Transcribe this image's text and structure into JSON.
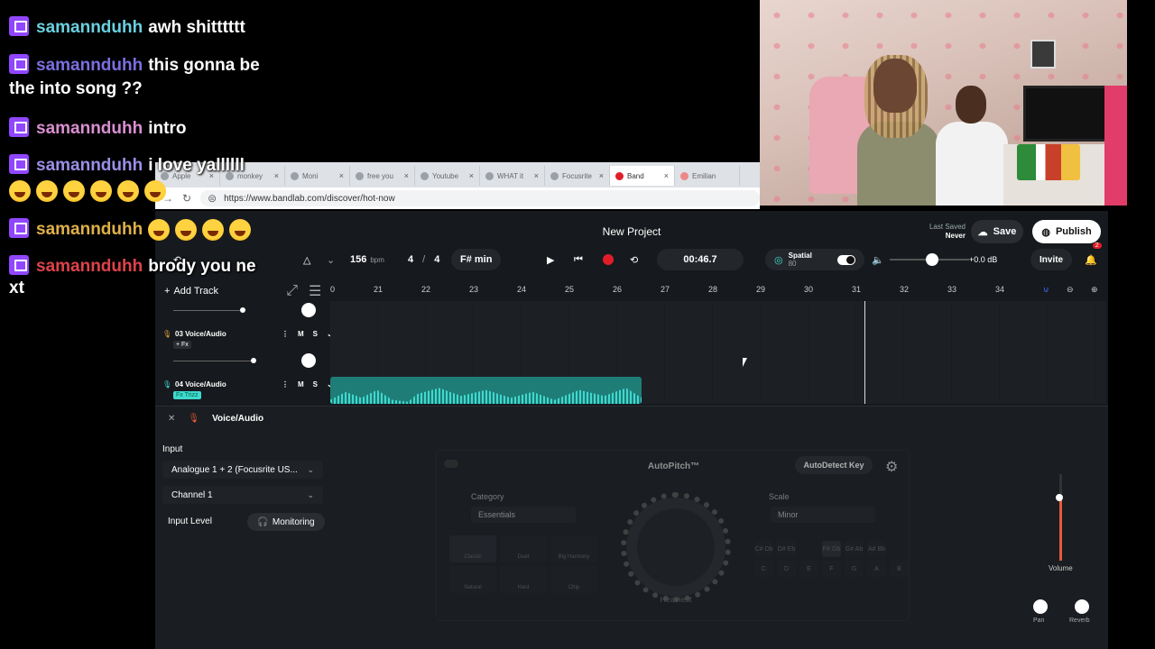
{
  "chat": {
    "messages": [
      {
        "user": "samannduhh",
        "user_color": "#6ad0df",
        "text": "awh shitttttt"
      },
      {
        "user": "samannduhh",
        "user_color": "#7b6fe0",
        "text": "this gonna be",
        "text_cont": "the into song ??"
      },
      {
        "user": "samannduhh",
        "user_color": "#d98fd0",
        "text": "intro"
      },
      {
        "user": "samannduhh",
        "user_color": "#9b8fe8",
        "text": "i love yallllll"
      },
      {
        "user": "samannduhh",
        "user_color": "#e0b04a",
        "text": ""
      },
      {
        "user": "samannduhh",
        "user_color": "#e0424a",
        "text": "brody you ne",
        "text_cont": "xt"
      }
    ]
  },
  "browser": {
    "tabs": [
      "Apple",
      "monkey",
      "Moni",
      "free you",
      "Youtube",
      "WHAT it",
      "Focusrite",
      "Band",
      "Emilian"
    ],
    "url": "https://www.bandlab.com/discover/hot-now"
  },
  "app": {
    "project_title": "New Project",
    "last_saved_label": "Last Saved",
    "last_saved_value": "Never",
    "save_label": "Save",
    "publish_label": "Publish",
    "bpm_value": "156",
    "bpm_unit": "bpm",
    "time_sig_num": "4",
    "time_sig_den": "4",
    "key": "F# min",
    "time": "00:46.7",
    "spatial_label": "Spatial",
    "spatial_sub": "80",
    "volume_db": "+0.0 dB",
    "invite_label": "Invite",
    "notif_count": "2",
    "add_track_label": "Add Track",
    "ruler": [
      "0",
      "21",
      "22",
      "23",
      "24",
      "25",
      "26",
      "27",
      "28",
      "29",
      "30",
      "31",
      "32",
      "33",
      "34"
    ],
    "tracks": [
      {
        "name": "03 Voice/Audio",
        "tag": "+ Fx",
        "mute": "M",
        "solo": "S"
      },
      {
        "name": "04 Voice/Audio",
        "tag": "Fx Trizz",
        "mute": "M",
        "solo": "S"
      }
    ],
    "panel": {
      "title": "Voice/Audio",
      "input_label": "Input",
      "input_device": "Analogue 1 + 2 (Focusrite US...",
      "channel": "Channel 1",
      "input_level_label": "Input Level",
      "monitoring_label": "Monitoring",
      "autopitch_title": "AutoPitch™",
      "autodetect_label": "AutoDetect Key",
      "category_label": "Category",
      "category_value": "Essentials",
      "scale_label": "Scale",
      "scale_value": "Minor",
      "heaviest_label": "Heaviest",
      "presets": [
        "Classic",
        "Duet",
        "Big Harmony",
        "Natural",
        "Hard",
        "Chip"
      ],
      "key_sharps": [
        "C# Db",
        "D# Eb",
        "",
        "F# Gb",
        "G# Ab",
        "A# Bb",
        ""
      ],
      "key_naturals": [
        "C",
        "D",
        "E",
        "F",
        "G",
        "A",
        "B"
      ],
      "volume_label": "Volume",
      "pan_label": "Pan",
      "reverb_label": "Reverb"
    }
  },
  "colors": {
    "accent_teal": "#3fd9cf",
    "record_red": "#e11d2a",
    "twitch_purple": "#9146ff"
  }
}
